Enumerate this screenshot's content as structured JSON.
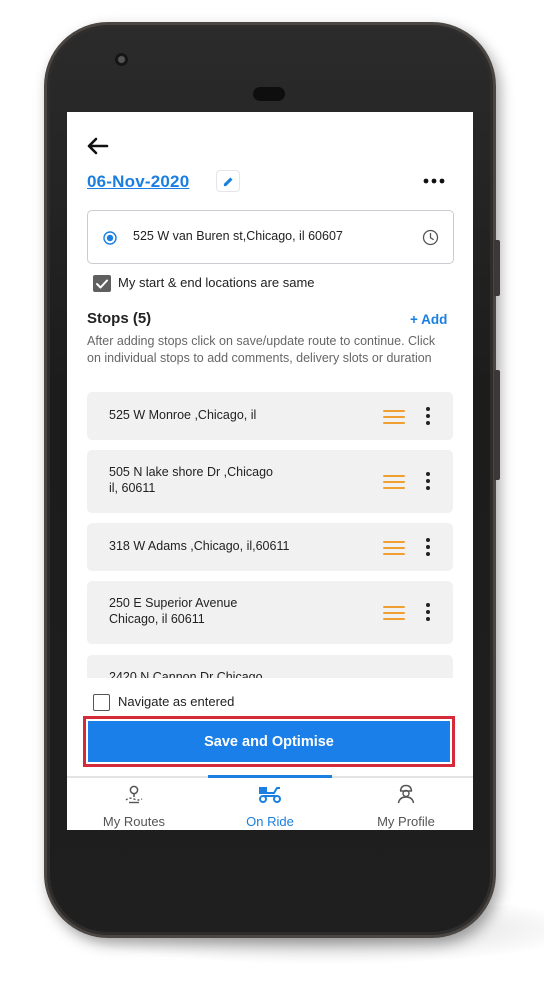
{
  "header": {
    "back_icon": "back-arrow-icon",
    "date": "06-Nov-2020",
    "edit_icon": "pencil-icon",
    "more_icon": "more-horizontal-icon"
  },
  "start_location": {
    "address": "525 W van Buren st,Chicago, il 60607",
    "radio_icon": "radio-selected-icon",
    "clock_icon": "clock-icon"
  },
  "same_locations": {
    "label": "My start & end locations are same",
    "checked": true
  },
  "stops": {
    "title": "Stops (5)",
    "add_label": "+ Add",
    "help_text": "After adding stops click on save/update route to continue. Click on individual stops to add comments, delivery slots or duration",
    "items": [
      {
        "address": "525 W Monroe ,Chicago, il"
      },
      {
        "address": "505 N lake shore Dr ,Chicago\nil, 60611"
      },
      {
        "address": "318 W Adams ,Chicago, il,60611"
      },
      {
        "address": "250 E Superior Avenue\nChicago, il 60611"
      },
      {
        "address": "2420 N Cannon Dr Chicago"
      }
    ]
  },
  "navigate_as_entered": {
    "label": "Navigate as entered",
    "checked": false
  },
  "save_button": {
    "label": "Save and Optimise"
  },
  "tabs": [
    {
      "label": "My Routes",
      "icon": "location-pin-icon",
      "active": false
    },
    {
      "label": "On Ride",
      "icon": "delivery-scooter-icon",
      "active": true
    },
    {
      "label": "My Profile",
      "icon": "profile-icon",
      "active": false
    }
  ],
  "colors": {
    "accent": "#1a7fe0",
    "handle": "#f0a030",
    "highlight_border": "#d42a3a"
  }
}
